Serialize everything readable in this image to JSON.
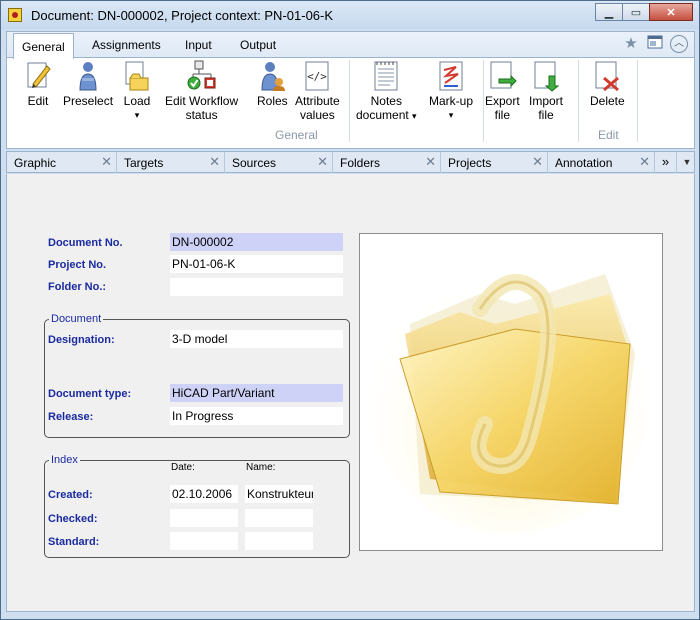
{
  "window": {
    "title": "Document: DN-000002, Project context: PN-01-06-K",
    "buttons": {
      "minimize": "▁",
      "maximize": "▭",
      "close": "✕"
    }
  },
  "ribbon": {
    "tabs": [
      "General",
      "Assignments",
      "Input",
      "Output"
    ],
    "active_tab": "General",
    "right_icons": [
      "star-icon",
      "window-icon",
      "collapse-icon"
    ],
    "buttons": [
      {
        "label": "Edit",
        "icon": "edit-document-icon"
      },
      {
        "label": "Preselect",
        "icon": "preselect-icon"
      },
      {
        "label": "Load",
        "arrow": "▾",
        "icon": "load-folder-icon"
      },
      {
        "label": "Edit Workflow",
        "label2": "status",
        "icon": "workflow-status-icon"
      },
      {
        "label": "Roles",
        "icon": "roles-icon"
      },
      {
        "label": "Attribute",
        "label2": "values",
        "icon": "attribute-values-icon"
      },
      {
        "label": "Notes",
        "label2": "document",
        "arrow": "▾",
        "icon": "notes-document-icon"
      },
      {
        "label": "Mark-up",
        "arrow": "▾",
        "icon": "markup-icon"
      },
      {
        "label": "Export",
        "label2": "file",
        "icon": "export-file-icon"
      },
      {
        "label": "Import",
        "label2": "file",
        "icon": "import-file-icon"
      },
      {
        "label": "Delete",
        "icon": "delete-icon"
      }
    ],
    "groups": [
      {
        "label": "General"
      },
      {
        "label": "Edit"
      }
    ]
  },
  "doc_tabs": {
    "tabs": [
      "Graphic",
      "Targets",
      "Sources",
      "Folders",
      "Projects",
      "Annotation"
    ],
    "close_glyph": "✕",
    "more": "»",
    "dropdown": "▼"
  },
  "form": {
    "document_no": {
      "label": "Document No.",
      "value": "DN-000002"
    },
    "project_no": {
      "label": "Project No.",
      "value": "PN-01-06-K"
    },
    "folder_no": {
      "label": "Folder No.:",
      "value": ""
    },
    "document_group": {
      "title": "Document",
      "designation": {
        "label": "Designation:",
        "value": "3-D model"
      },
      "document_type": {
        "label": "Document type:",
        "value": "HiCAD Part/Variant"
      },
      "release": {
        "label": "Release:",
        "value": "In Progress"
      }
    },
    "index_group": {
      "title": "Index",
      "date_header": "Date:",
      "name_header": "Name:",
      "created": {
        "label": "Created:",
        "date": "02.10.2006",
        "name": "Konstrukteur"
      },
      "checked": {
        "label": "Checked:",
        "date": "",
        "name": ""
      },
      "standard": {
        "label": "Standard:",
        "date": "",
        "name": ""
      }
    }
  },
  "preview": {
    "icon": "folder-preview-icon"
  },
  "colors": {
    "label_blue": "#1a2aa0",
    "highlight_field": "#cdd2f6",
    "frame": "#cfdff0"
  }
}
